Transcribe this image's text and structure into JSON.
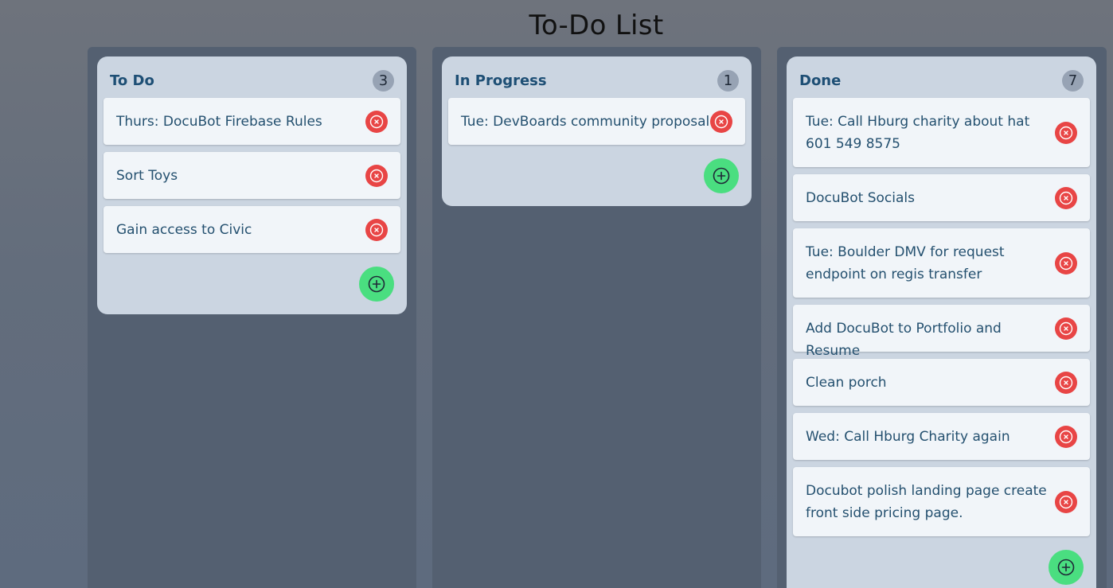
{
  "app": {
    "title": "To-Do List"
  },
  "columns": [
    {
      "title": "To Do",
      "count": "3",
      "tasks": [
        {
          "text": "Thurs: DocuBot Firebase Rules"
        },
        {
          "text": "Sort Toys"
        },
        {
          "text": "Gain access to Civic"
        }
      ]
    },
    {
      "title": "In Progress",
      "count": "1",
      "tasks": [
        {
          "text": "Tue: DevBoards community proposal"
        }
      ]
    },
    {
      "title": "Done",
      "count": "7",
      "tasks": [
        {
          "text": "Tue: Call Hburg charity about hat 601 549 8575"
        },
        {
          "text": "DocuBot Socials"
        },
        {
          "text": "Tue: Boulder DMV for request endpoint on regis transfer"
        },
        {
          "text": "Add DocuBot to Portfolio and Resume"
        },
        {
          "text": "Clean porch"
        },
        {
          "text": "Wed: Call Hburg Charity again"
        },
        {
          "text": "Docubot polish landing page create front side pricing page."
        }
      ]
    }
  ],
  "icons": {
    "delete": "circle-x-icon",
    "add": "circle-plus-icon"
  },
  "colors": {
    "delete_button": "#e84545",
    "add_button": "#4ade80",
    "column_title": "#1e4f75",
    "task_text": "#24506f"
  }
}
